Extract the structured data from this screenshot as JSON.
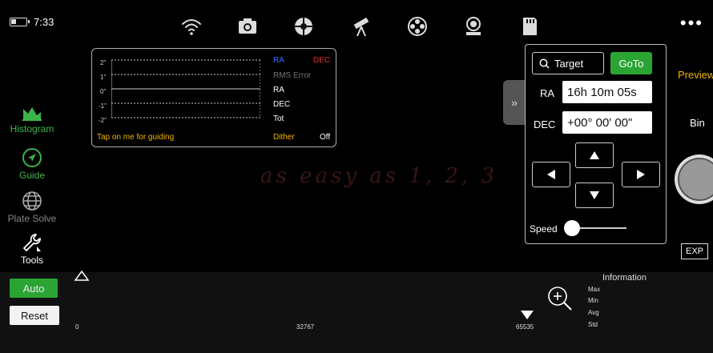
{
  "status": {
    "time": "7:33"
  },
  "top_icons": [
    "wifi-icon",
    "camera-icon",
    "focuser-icon",
    "telescope-icon",
    "filter-wheel-icon",
    "mount-icon",
    "sd-card-icon"
  ],
  "more_label": "•••",
  "left_menu": {
    "histogram": "Histogram",
    "guide": "Guide",
    "plate_solve": "Plate Solve",
    "tools": "Tools"
  },
  "guide_graph": {
    "y_ticks": [
      "2\"",
      "1\"",
      "0\"",
      "-1\"",
      "-2\""
    ],
    "ra_label": "RA",
    "dec_label": "DEC",
    "rms_label": "RMS Error",
    "row_ra": "RA",
    "row_dec": "DEC",
    "row_tot": "Tot",
    "tap_text": "Tap on me for guiding",
    "dither_label": "Dither",
    "dither_value": "Off",
    "colors": {
      "ra": "#3a6bff",
      "dec": "#e03030",
      "accent": "#f0b400"
    }
  },
  "tagline": "as easy as 1, 2, 3",
  "goto": {
    "target_label": "Target",
    "goto_label": "GoTo",
    "ra_label": "RA",
    "ra_value": "16h 10m 05s",
    "dec_label": "DEC",
    "dec_value": "+00° 00' 00\"",
    "speed_label": "Speed",
    "speed_level": 0
  },
  "right": {
    "preview": "Preview",
    "bin": "Bin",
    "exp": "EXP"
  },
  "histogram": {
    "auto_label": "Auto",
    "reset_label": "Reset",
    "min_value": "0",
    "mid_value": "32767",
    "max_value": "65535",
    "info_title": "Information",
    "info_labels": [
      "Max",
      "Min",
      "Avg",
      "Std"
    ]
  }
}
